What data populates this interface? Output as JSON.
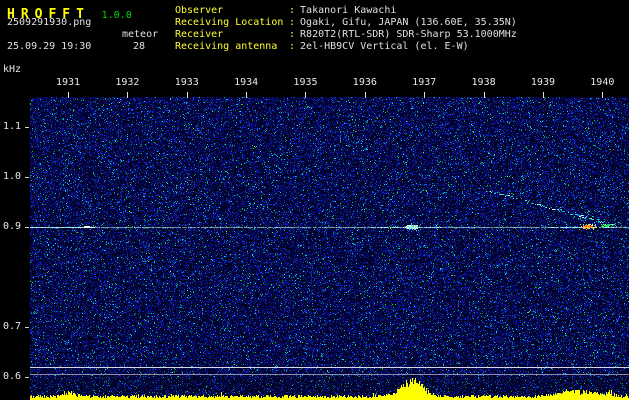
{
  "header": {
    "app_name": "HROFFT",
    "version": "1.0.0",
    "filename": "2509291930.png",
    "mode": "meteor",
    "datetime": "25.09.29 19:30",
    "count": "28",
    "colon": ":",
    "info": [
      {
        "label": "Observer",
        "value": "Takanori Kawachi"
      },
      {
        "label": "Receiving Location",
        "value": "Ogaki, Gifu, JAPAN (136.60E, 35.35N)"
      },
      {
        "label": "Receiver",
        "value": "R820T2(RTL-SDR) SDR-Sharp 53.1000MHz"
      },
      {
        "label": "Receiving antenna",
        "value": "2el-HB9CV Vertical (el. E-W)"
      }
    ]
  },
  "chart_data": {
    "type": "heatmap",
    "title": "HROFFT radio meteor spectrogram 19:30-19:40",
    "ylabel": "kHz",
    "x_labels": [
      "1931",
      "1932",
      "1933",
      "1934",
      "1935",
      "1936",
      "1937",
      "1938",
      "1939",
      "1940"
    ],
    "y_ticks": [
      1.1,
      1.0,
      0.9,
      0.7,
      0.6
    ],
    "ylim": [
      0.58,
      1.17
    ],
    "grid": false,
    "background": "dark blue random noise field",
    "carrier_line_khz": 0.9,
    "accent_colors": {
      "noise": "#0000a0",
      "carrier": "#a0e0e0",
      "level_graph": "#ffff00"
    },
    "events": [
      {
        "time": "1936.9",
        "freq_khz": 0.9,
        "kind": "meteor echo",
        "strength": "moderate",
        "color": "cyan-white"
      },
      {
        "time": "1939.4",
        "freq_khz": 0.9,
        "kind": "meteor echo with descending Doppler trail",
        "strength": "strong",
        "trail_from": {
          "time": "1937.6",
          "freq_khz": 0.97
        },
        "color": "orange-red core with green tail"
      }
    ],
    "signal_level_strip": {
      "color": "#ffff00",
      "peaks": [
        {
          "time": "1936.9",
          "height": "high"
        },
        {
          "time": "1939.3",
          "height": "medium"
        },
        {
          "time": "1930.2",
          "height": "low"
        }
      ]
    }
  }
}
